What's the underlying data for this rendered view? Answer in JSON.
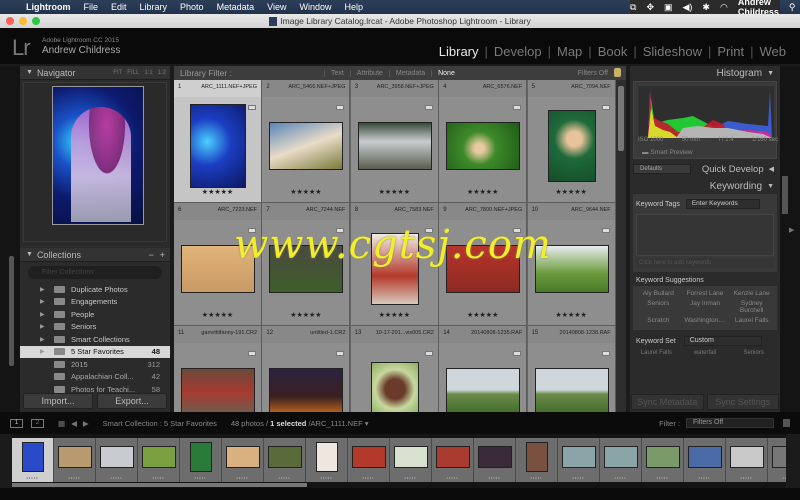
{
  "menubar": {
    "app": "Lightroom",
    "items": [
      "File",
      "Edit",
      "Library",
      "Photo",
      "Metadata",
      "View",
      "Window",
      "Help"
    ],
    "user": "Andrew Childress"
  },
  "window": {
    "title": "Image Library Catalog.lrcat - Adobe Photoshop Lightroom - Library"
  },
  "header": {
    "logo": "Lr",
    "product": "Adobe Lightroom CC 2015",
    "user": "Andrew Childress",
    "modules": [
      "Library",
      "Develop",
      "Map",
      "Book",
      "Slideshow",
      "Print",
      "Web"
    ],
    "active_module": "Library"
  },
  "navigator": {
    "title": "Navigator",
    "options": [
      "FIT",
      "FILL",
      "1:1",
      "1:2"
    ]
  },
  "collections": {
    "title": "Collections",
    "filter_placeholder": "Filter Collections",
    "items": [
      {
        "label": "Duplicate Photos",
        "count": ""
      },
      {
        "label": "Engagements",
        "count": ""
      },
      {
        "label": "People",
        "count": ""
      },
      {
        "label": "Seniors",
        "count": ""
      },
      {
        "label": "Smart Collections",
        "count": ""
      },
      {
        "label": "5 Star Favorites",
        "count": "48",
        "selected": true
      },
      {
        "label": "2015",
        "count": "312"
      },
      {
        "label": "Appalachian Coll...",
        "count": "42"
      },
      {
        "label": "Photos for Teachi...",
        "count": "58"
      }
    ],
    "import_label": "Import...",
    "export_label": "Export..."
  },
  "library_filter": {
    "label": "Library Filter :",
    "options": [
      "Text",
      "Attribute",
      "Metadata",
      "None"
    ],
    "active": "None",
    "preset": "Filters Off"
  },
  "grid": {
    "cells": [
      {
        "index": "1",
        "name": "ARC_1111.NEF+JPEG",
        "rating": "★★★★★",
        "selected": true
      },
      {
        "index": "2",
        "name": "ARC_5466.NEF+JPEG",
        "rating": "★★★★★"
      },
      {
        "index": "3",
        "name": "ARC_3958.NEF+JPEG",
        "rating": "★★★★★"
      },
      {
        "index": "4",
        "name": "ARC_6576.NEF",
        "rating": "★★★★★"
      },
      {
        "index": "5",
        "name": "ARC_7094.NEF",
        "rating": "★★★★★"
      },
      {
        "index": "6",
        "name": "ARC_7223.NEF",
        "rating": "★★★★★"
      },
      {
        "index": "7",
        "name": "ARC_7244.NEF",
        "rating": "★★★★★"
      },
      {
        "index": "8",
        "name": "ARC_7583.NEF",
        "rating": "★★★★★"
      },
      {
        "index": "9",
        "name": "ARC_7800.NEF+JPEG",
        "rating": "★★★★★"
      },
      {
        "index": "10",
        "name": "ARC_9644.NEF",
        "rating": "★★★★★"
      },
      {
        "index": "11",
        "name": "garretttifanny-191.CR2",
        "rating": ""
      },
      {
        "index": "12",
        "name": "untitled-1.CR2",
        "rating": ""
      },
      {
        "index": "13",
        "name": "10-17-201...vis005.CR2",
        "rating": ""
      },
      {
        "index": "14",
        "name": "20140808-1235.RAF",
        "rating": ""
      },
      {
        "index": "15",
        "name": "20140808-1238.RAF",
        "rating": ""
      }
    ]
  },
  "histogram": {
    "title": "Histogram",
    "iso": "ISO 1000",
    "focal": "50 mm",
    "aperture": "f / 1.4",
    "shutter": "1/160 sec",
    "smart_preview": "Smart Preview"
  },
  "quick_develop": {
    "title": "Quick Develop",
    "preset": "Defaults"
  },
  "keywording": {
    "title": "Keywording",
    "tags_label": "Keyword Tags",
    "tags_mode": "Enter Keywords",
    "add_placeholder": "Click here to add keywords",
    "suggestions_label": "Keyword Suggestions",
    "suggestions": [
      "Aly Bullard",
      "Forrest Lane",
      "Kenzie Lane",
      "Seniors",
      "Jay Inman",
      "Sydney Burchell",
      "Scratch",
      "Washington....",
      "Laurel Falls"
    ],
    "set_label": "Keyword Set",
    "set_value": "Custom",
    "set_items": [
      "Laurel Falls",
      "waterfall",
      "Seniors"
    ]
  },
  "sync": {
    "metadata_label": "Sync Metadata",
    "settings_label": "Sync Settings"
  },
  "filmstrip_bar": {
    "screen1": "1",
    "screen2": "2",
    "source": "Smart Collection : 5 Star Favorites",
    "count": "48 photos /",
    "selected": "1 selected",
    "file": "/ARC_1111.NEF",
    "filter_label": "Filter :",
    "filter_value": "Filters Off"
  },
  "filmstrip": {
    "ratings": "•••••",
    "count": 19
  },
  "watermark": "www.cgtsj.com"
}
